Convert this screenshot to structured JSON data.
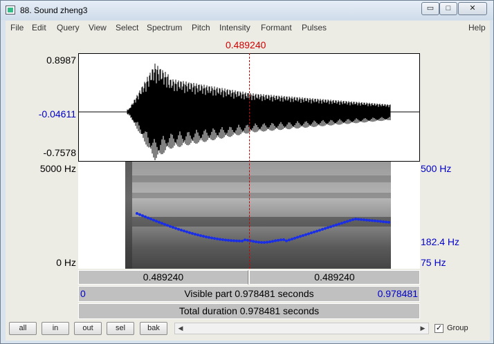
{
  "window": {
    "title": "88. Sound zheng3",
    "minimize_glyph": "▭",
    "maximize_glyph": "□",
    "close_glyph": "✕"
  },
  "menubar": {
    "items": [
      "File",
      "Edit",
      "Query",
      "View",
      "Select",
      "Spectrum",
      "Pitch",
      "Intensity",
      "Formant",
      "Pulses"
    ],
    "help": "Help"
  },
  "cursor": {
    "time_label": "0.489240",
    "color": "#d00000"
  },
  "waveform": {
    "y_max": "0.8987",
    "y_mid": "-0.04611",
    "y_min": "-0.7578"
  },
  "spectrogram": {
    "freq_max": "5000 Hz",
    "freq_min": "0 Hz",
    "pitch_max": "500 Hz",
    "pitch_cursor": "182.4 Hz",
    "pitch_min": "75 Hz",
    "pitch_color": "#1a2ee6"
  },
  "time_bars": {
    "left_time": "0.489240",
    "right_time": "0.489240",
    "visible_start": "0",
    "visible_label": "Visible part 0.978481 seconds",
    "visible_end": "0.978481",
    "total_label": "Total duration 0.978481 seconds"
  },
  "bottom": {
    "buttons": [
      "all",
      "in",
      "out",
      "sel",
      "bak"
    ],
    "group_checked": "✓",
    "group_label": "Group",
    "scroll_left": "◀",
    "scroll_right": "▶"
  }
}
